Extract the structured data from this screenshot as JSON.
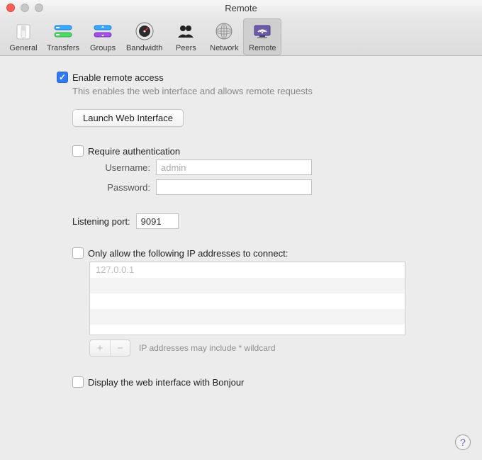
{
  "window": {
    "title": "Remote"
  },
  "toolbar": {
    "items": [
      {
        "label": "General"
      },
      {
        "label": "Transfers"
      },
      {
        "label": "Groups"
      },
      {
        "label": "Bandwidth"
      },
      {
        "label": "Peers"
      },
      {
        "label": "Network"
      },
      {
        "label": "Remote"
      }
    ],
    "selected": 6
  },
  "remote": {
    "enable_label": "Enable remote access",
    "enable_checked": true,
    "enable_desc": "This enables the web interface and allows remote requests",
    "launch_button": "Launch Web Interface",
    "auth": {
      "require_label": "Require authentication",
      "require_checked": false,
      "username_label": "Username:",
      "username_value": "admin",
      "password_label": "Password:",
      "password_value": ""
    },
    "port": {
      "label": "Listening port:",
      "value": "9091"
    },
    "whitelist": {
      "label": "Only allow the following IP addresses to connect:",
      "checked": false,
      "entries": [
        "127.0.0.1"
      ],
      "hint": "IP addresses may include * wildcard",
      "add": "+",
      "remove": "−"
    },
    "bonjour": {
      "label": "Display the web interface with Bonjour",
      "checked": false
    }
  },
  "help": "?"
}
